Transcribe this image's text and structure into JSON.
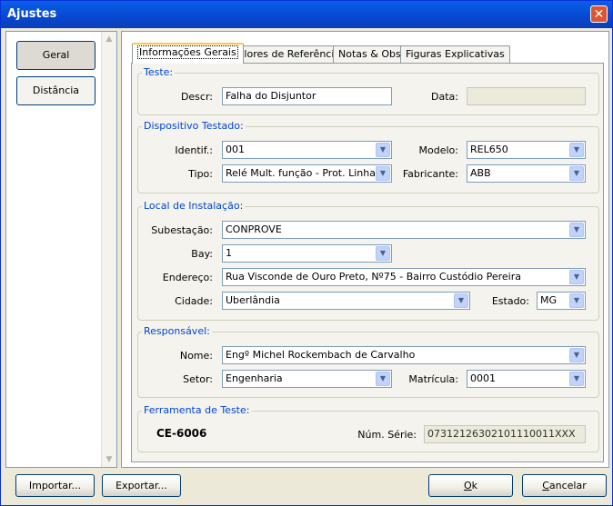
{
  "window": {
    "title": "Ajustes",
    "close_symbol": "✕"
  },
  "sidebar": {
    "items": [
      {
        "label": "Geral"
      },
      {
        "label": "Distância"
      }
    ]
  },
  "tabs": [
    {
      "label": "Informações Gerais"
    },
    {
      "label": "Valores de Referência"
    },
    {
      "label": "Notas & Obs."
    },
    {
      "label": "Figuras Explicativas"
    }
  ],
  "teste": {
    "group": "Teste:",
    "descr_label": "Descr:",
    "descr_value": "Falha do Disjuntor",
    "data_label": "Data:",
    "data_value": ""
  },
  "dispositivo": {
    "group": "Dispositivo Testado:",
    "identif_label": "Identif.:",
    "identif_value": "001",
    "modelo_label": "Modelo:",
    "modelo_value": "REL650",
    "tipo_label": "Tipo:",
    "tipo_value": "Relé Mult. função - Prot. Linha",
    "fabricante_label": "Fabricante:",
    "fabricante_value": "ABB"
  },
  "local": {
    "group": "Local de Instalação:",
    "subestacao_label": "Subestação:",
    "subestacao_value": "CONPROVE",
    "bay_label": "Bay:",
    "bay_value": "1",
    "endereco_label": "Endereço:",
    "endereco_value": "Rua Visconde de Ouro Preto, Nº75 - Bairro Custódio Pereira",
    "cidade_label": "Cidade:",
    "cidade_value": "Uberlândia",
    "estado_label": "Estado:",
    "estado_value": "MG"
  },
  "responsavel": {
    "group": "Responsável:",
    "nome_label": "Nome:",
    "nome_value": "Engº Michel Rockembach de Carvalho",
    "setor_label": "Setor:",
    "setor_value": "Engenharia",
    "matricula_label": "Matrícula:",
    "matricula_value": "0001"
  },
  "ferramenta": {
    "group": "Ferramenta de Teste:",
    "model": "CE-6006",
    "serie_label": "Núm. Série:",
    "serie_value": "07312126302101110011XXX"
  },
  "buttons": {
    "importar": "Importar...",
    "exportar": "Exportar...",
    "ok_u": "O",
    "ok_rest": "k",
    "cancelar_u": "C",
    "cancelar_rest": "ancelar"
  },
  "icons": {
    "dropdown": "chevron-down-icon",
    "close": "close-icon",
    "scroll_up": "arrow-up-icon",
    "scroll_down": "arrow-down-icon"
  }
}
